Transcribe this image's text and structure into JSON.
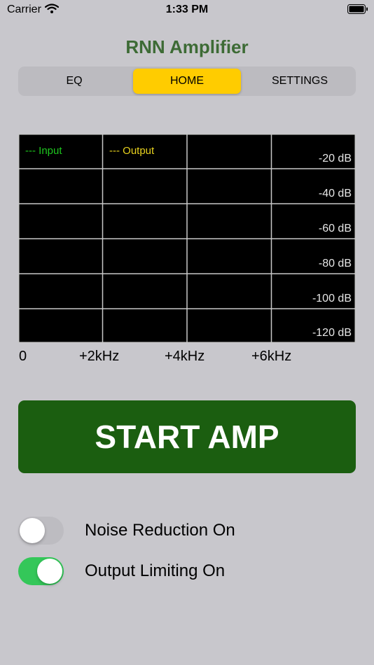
{
  "status_bar": {
    "carrier": "Carrier",
    "time": "1:33 PM"
  },
  "app": {
    "title": "RNN Amplifier"
  },
  "tabs": [
    {
      "label": "EQ",
      "selected": false
    },
    {
      "label": "HOME",
      "selected": true
    },
    {
      "label": "SETTINGS",
      "selected": false
    }
  ],
  "spectrum": {
    "legend_input": "--- Input",
    "legend_output": "--- Output",
    "db_labels": [
      "-20 dB",
      "-40 dB",
      "-60 dB",
      "-80 dB",
      "-100 dB",
      "-120 dB"
    ],
    "freq_labels": [
      "0",
      "+2kHz",
      "+4kHz",
      "+6kHz"
    ],
    "colors": {
      "input": "#1ec61e",
      "output": "#e8d21e",
      "background": "#000000",
      "grid": "#c8c8c8"
    }
  },
  "start_button": {
    "label": "START AMP",
    "color": "#1b5e10"
  },
  "toggles": [
    {
      "label": "Noise Reduction On",
      "on": false
    },
    {
      "label": "Output Limiting On",
      "on": true
    }
  ],
  "colors": {
    "accent": "#ffcc00",
    "title": "#3d6b35",
    "switch_on": "#34c759"
  }
}
